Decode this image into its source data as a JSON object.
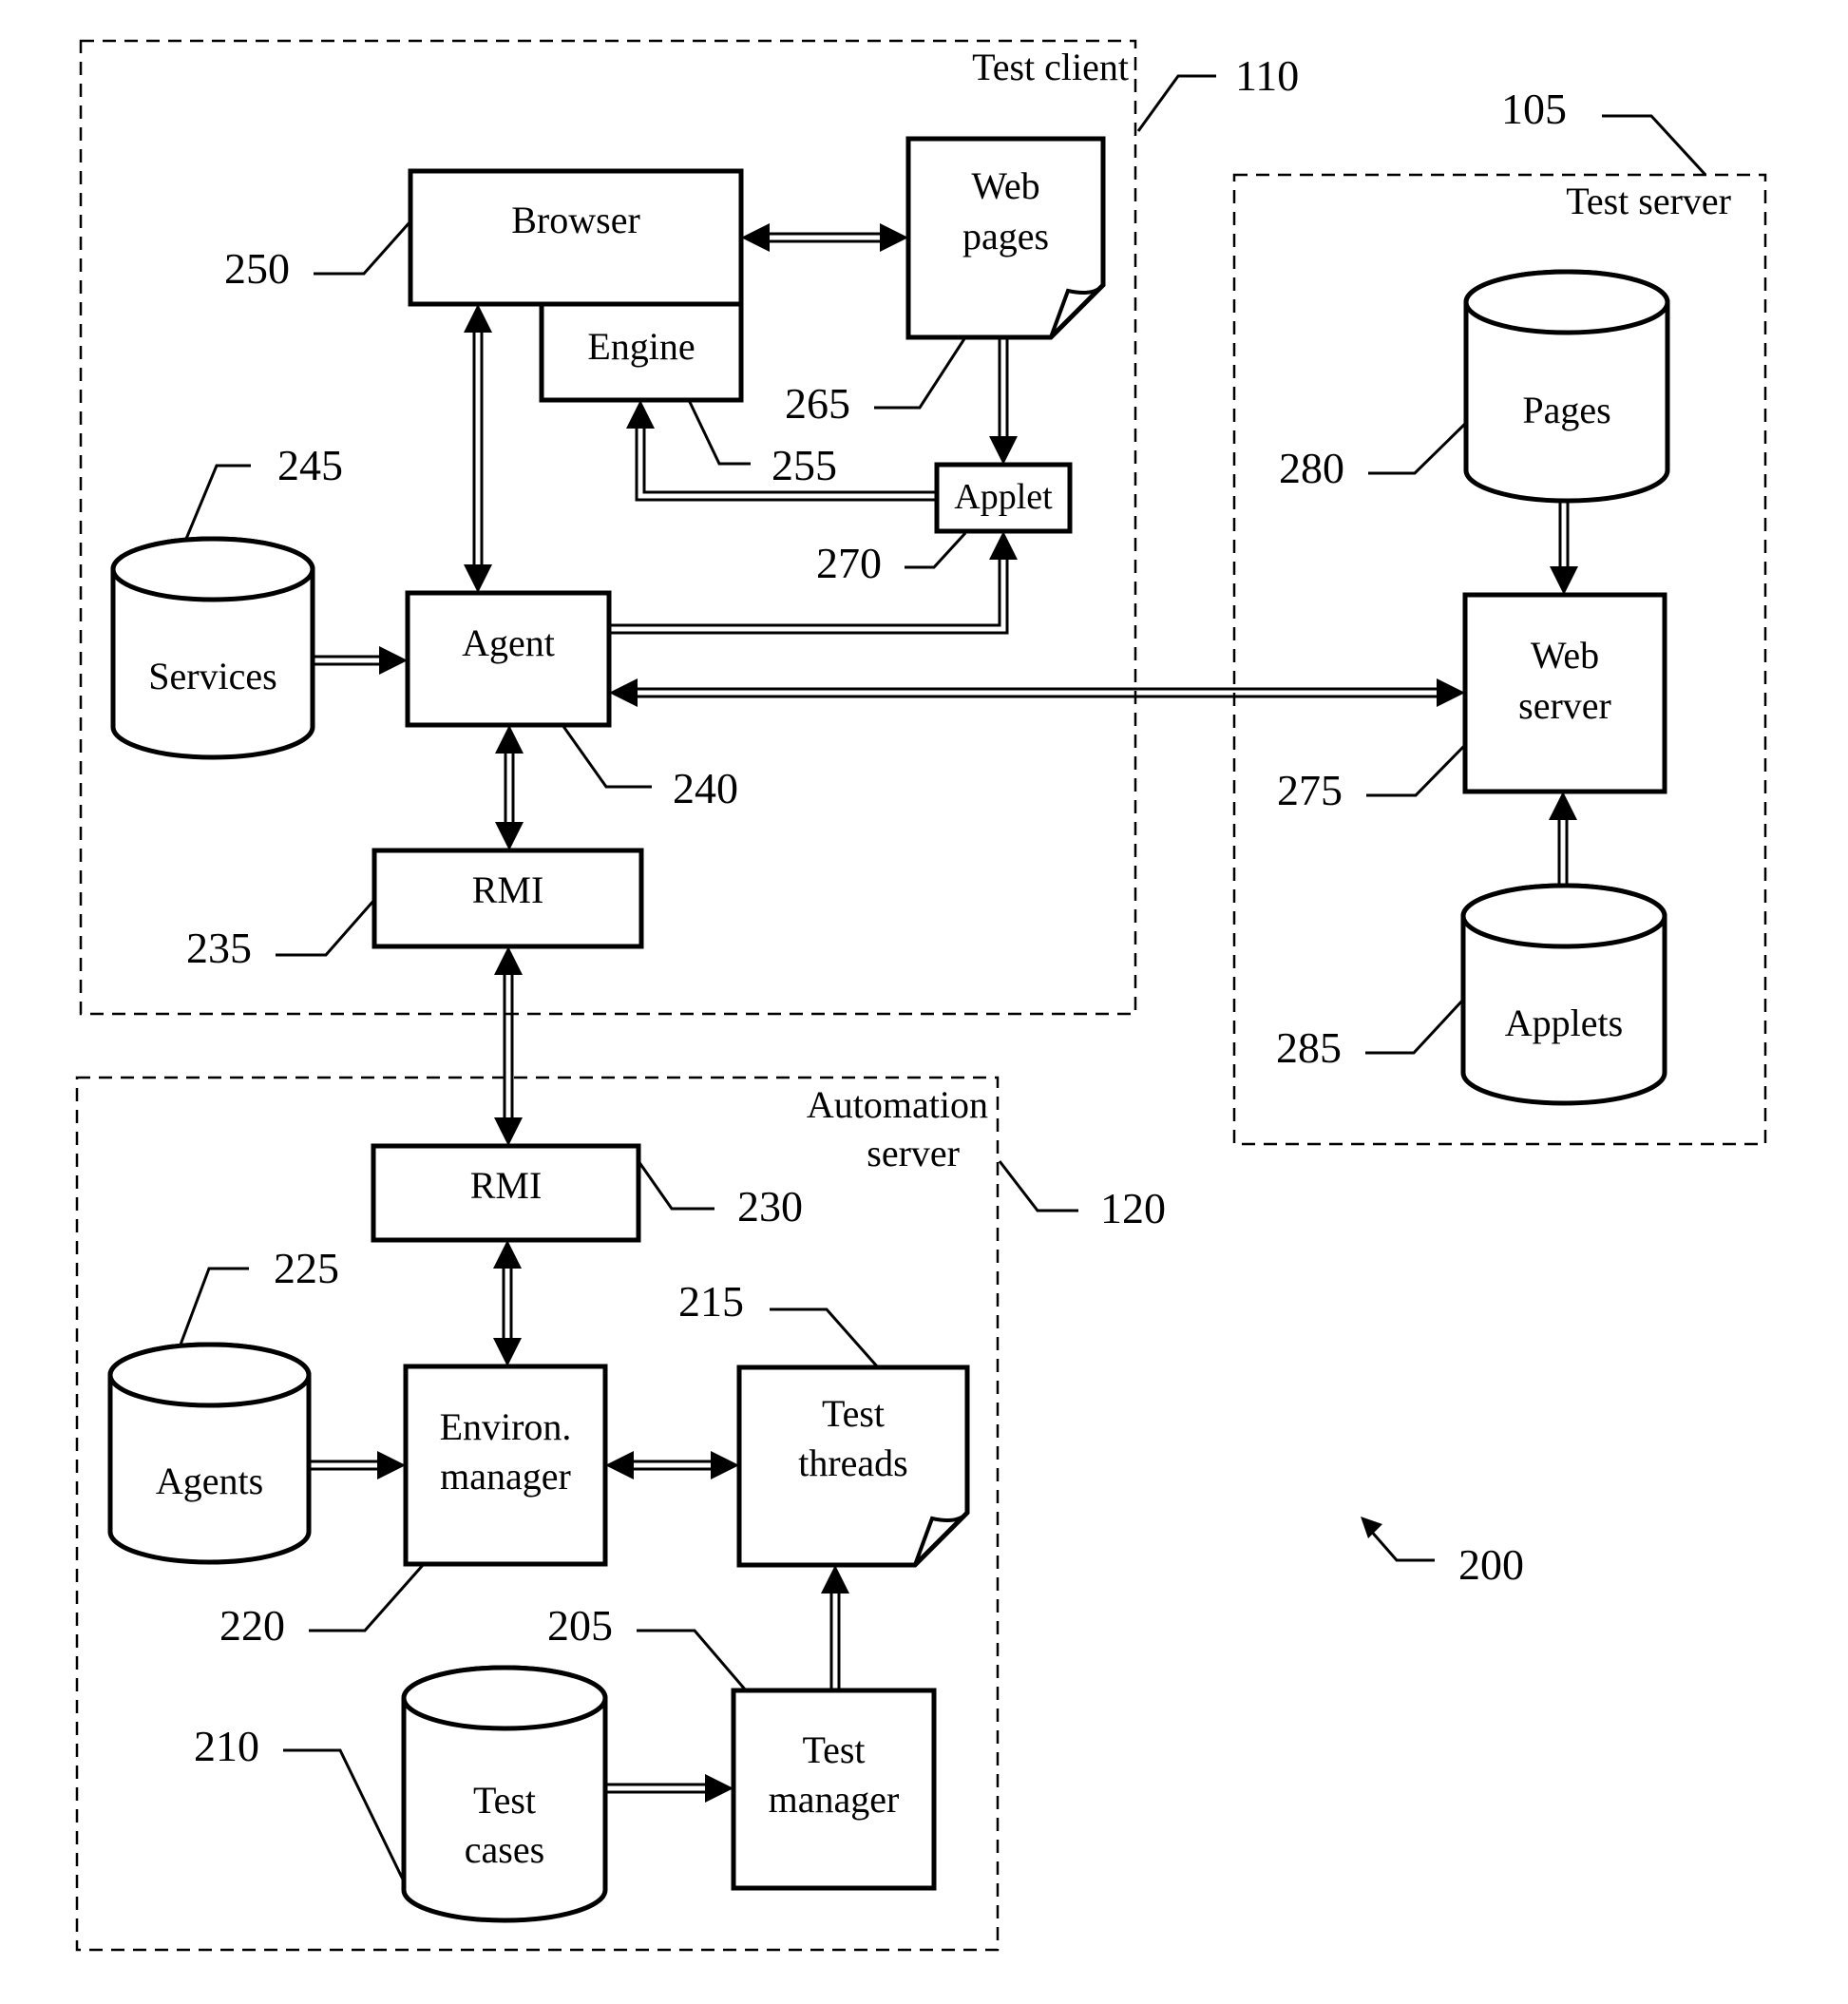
{
  "figure": {
    "ref": "200",
    "groups": [
      {
        "id": "test_client",
        "label": [
          "Test client"
        ],
        "ref": "110"
      },
      {
        "id": "test_server",
        "label": [
          "Test server"
        ],
        "ref": "105"
      },
      {
        "id": "automation_server",
        "label": [
          "Automation",
          "server"
        ],
        "ref": "120"
      }
    ],
    "nodes": [
      {
        "id": "browser",
        "kind": "box",
        "label": [
          "Browser"
        ],
        "ref": "250"
      },
      {
        "id": "engine",
        "kind": "box",
        "label": [
          "Engine"
        ],
        "ref": "255"
      },
      {
        "id": "web_pages",
        "kind": "document",
        "label": [
          "Web",
          "pages"
        ],
        "ref": "265"
      },
      {
        "id": "applet",
        "kind": "box",
        "label": [
          "Applet"
        ],
        "ref": "270"
      },
      {
        "id": "services",
        "kind": "database",
        "label": [
          "Services"
        ],
        "ref": "245"
      },
      {
        "id": "agent",
        "kind": "box",
        "label": [
          "Agent"
        ],
        "ref": "240"
      },
      {
        "id": "rmi_client",
        "kind": "box",
        "label": [
          "RMI"
        ],
        "ref": "235"
      },
      {
        "id": "pages",
        "kind": "database",
        "label": [
          "Pages"
        ],
        "ref": "280"
      },
      {
        "id": "web_server",
        "kind": "box",
        "label": [
          "Web",
          "server"
        ],
        "ref": "275"
      },
      {
        "id": "applets",
        "kind": "database",
        "label": [
          "Applets"
        ],
        "ref": "285"
      },
      {
        "id": "rmi_server",
        "kind": "box",
        "label": [
          "RMI"
        ],
        "ref": "230"
      },
      {
        "id": "agents",
        "kind": "database",
        "label": [
          "Agents"
        ],
        "ref": "225"
      },
      {
        "id": "environ_manager",
        "kind": "box",
        "label": [
          "Environ.",
          "manager"
        ],
        "ref": "220"
      },
      {
        "id": "test_threads",
        "kind": "document",
        "label": [
          "Test",
          "threads"
        ],
        "ref": "215"
      },
      {
        "id": "test_cases",
        "kind": "database",
        "label": [
          "Test",
          "cases"
        ],
        "ref": "210"
      },
      {
        "id": "test_manager",
        "kind": "box",
        "label": [
          "Test",
          "manager"
        ],
        "ref": "205"
      }
    ],
    "edges": [
      {
        "from": "browser",
        "to": "web_pages",
        "direction": "both"
      },
      {
        "from": "web_pages",
        "to": "applet",
        "direction": "forward"
      },
      {
        "from": "applet",
        "to": "engine",
        "direction": "forward"
      },
      {
        "from": "browser",
        "to": "agent",
        "direction": "both"
      },
      {
        "from": "agent",
        "to": "applet",
        "direction": "forward"
      },
      {
        "from": "services",
        "to": "agent",
        "direction": "forward"
      },
      {
        "from": "agent",
        "to": "web_server",
        "direction": "both"
      },
      {
        "from": "agent",
        "to": "rmi_client",
        "direction": "both"
      },
      {
        "from": "rmi_client",
        "to": "rmi_server",
        "direction": "both"
      },
      {
        "from": "pages",
        "to": "web_server",
        "direction": "forward"
      },
      {
        "from": "applets",
        "to": "web_server",
        "direction": "forward"
      },
      {
        "from": "rmi_server",
        "to": "environ_manager",
        "direction": "both"
      },
      {
        "from": "agents",
        "to": "environ_manager",
        "direction": "forward"
      },
      {
        "from": "environ_manager",
        "to": "test_threads",
        "direction": "both"
      },
      {
        "from": "test_cases",
        "to": "test_manager",
        "direction": "forward"
      },
      {
        "from": "test_manager",
        "to": "test_threads",
        "direction": "forward"
      }
    ]
  }
}
